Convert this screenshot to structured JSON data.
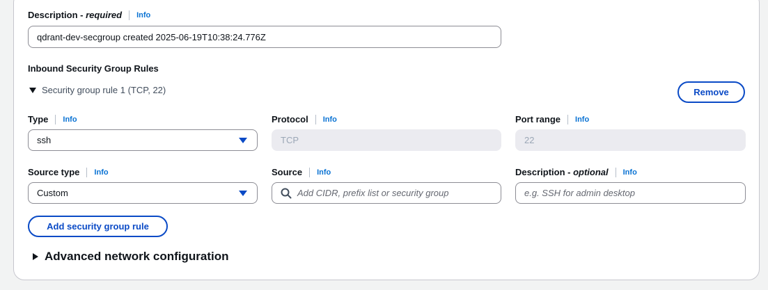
{
  "description": {
    "label": "Description",
    "label_suffix": "required",
    "info": "Info",
    "value": "qdrant-dev-secgroup created 2025-06-19T10:38:24.776Z"
  },
  "inbound": {
    "heading": "Inbound Security Group Rules",
    "rule_title": "Security group rule 1 (TCP, 22)",
    "remove_label": "Remove",
    "type": {
      "label": "Type",
      "info": "Info",
      "value": "ssh"
    },
    "protocol": {
      "label": "Protocol",
      "info": "Info",
      "value": "TCP"
    },
    "port_range": {
      "label": "Port range",
      "info": "Info",
      "value": "22"
    },
    "source_type": {
      "label": "Source type",
      "info": "Info",
      "value": "Custom"
    },
    "source": {
      "label": "Source",
      "info": "Info",
      "placeholder": "Add CIDR, prefix list or security group"
    },
    "rule_description": {
      "label": "Description",
      "label_suffix": "optional",
      "info": "Info",
      "placeholder": "e.g. SSH for admin desktop"
    },
    "add_rule_label": "Add security group rule"
  },
  "advanced": {
    "label": "Advanced network configuration"
  },
  "colors": {
    "accent": "#0a4ac6",
    "info": "#0972d3",
    "border": "#8c8c94"
  }
}
